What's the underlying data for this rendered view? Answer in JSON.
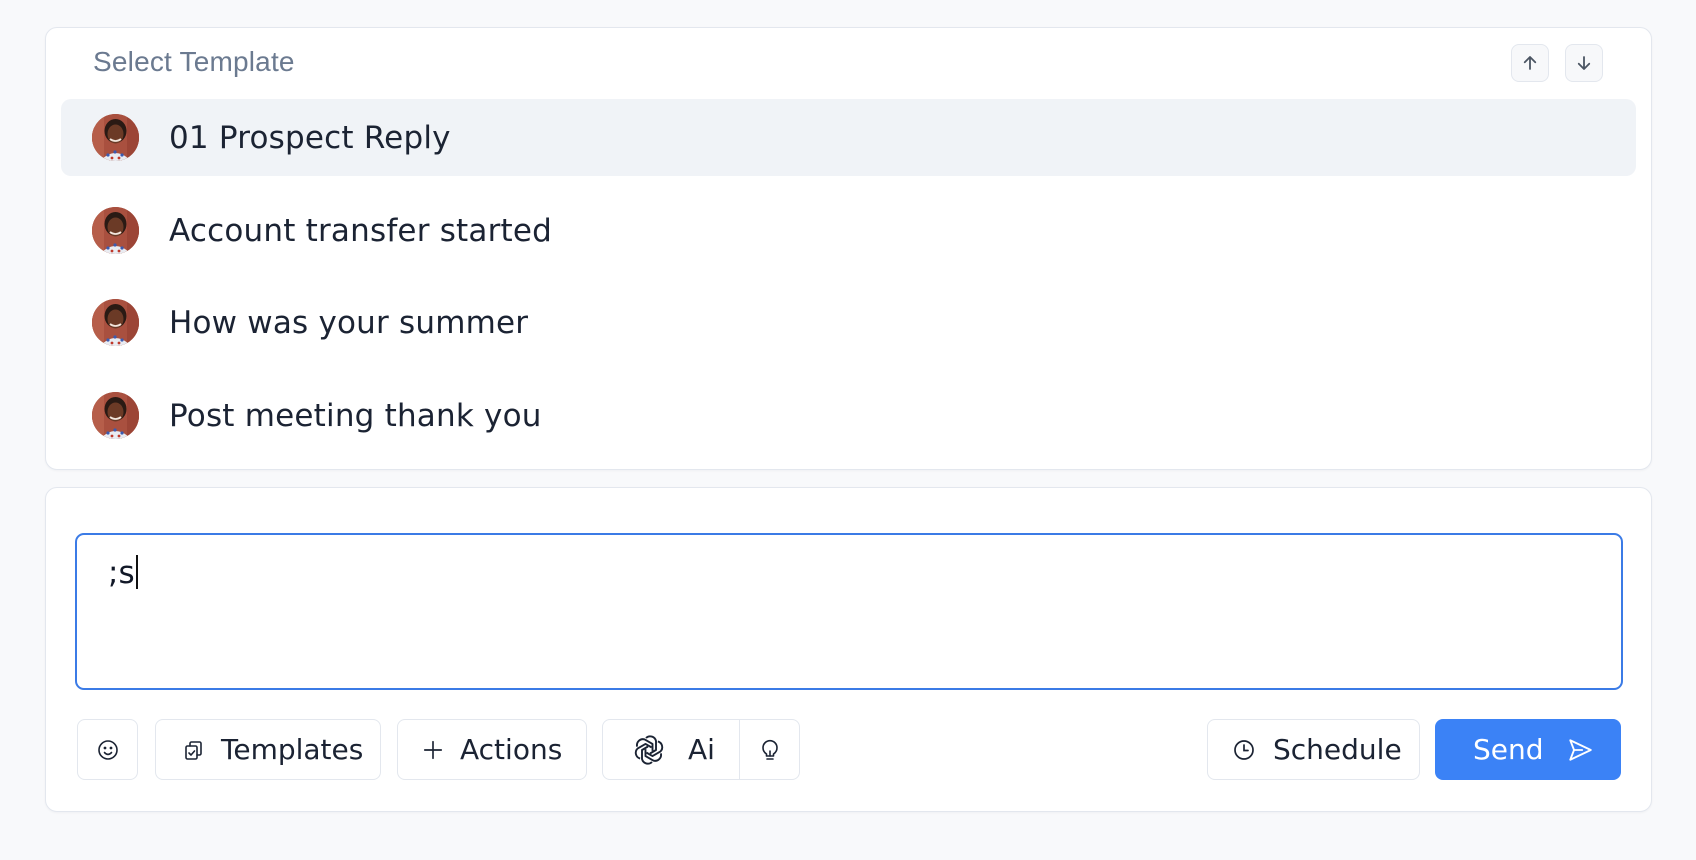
{
  "picker": {
    "title": "Select Template",
    "nav_up_icon": "arrow-up-icon",
    "nav_down_icon": "arrow-down-icon",
    "templates": [
      {
        "label": "01 Prospect Reply",
        "active": true
      },
      {
        "label": "Account transfer started",
        "active": false
      },
      {
        "label": "How was your summer",
        "active": false
      },
      {
        "label": "Post meeting thank you",
        "active": false
      }
    ]
  },
  "composer": {
    "message_value": ";s",
    "toolbar": {
      "emoji_icon": "smiley-icon",
      "templates_label": "Templates",
      "templates_icon": "clipboard-icon",
      "actions_label": "Actions",
      "actions_icon": "plus-icon",
      "ai_label": "Ai",
      "ai_icon": "openai-icon",
      "ideas_icon": "lightbulb-icon",
      "schedule_label": "Schedule",
      "schedule_icon": "clock-icon",
      "send_label": "Send",
      "send_icon": "paper-plane-icon"
    }
  },
  "colors": {
    "accent": "#3b82f6",
    "focus_border": "#3b7be6",
    "active_row": "#f0f3f7"
  }
}
